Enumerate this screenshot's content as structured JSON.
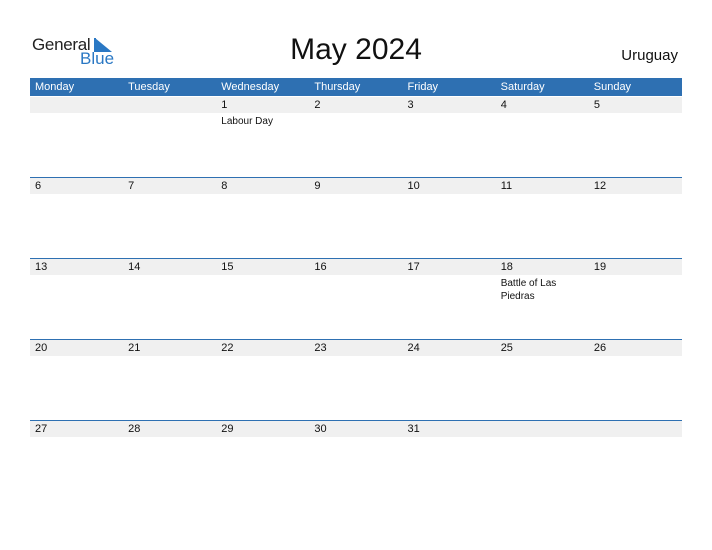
{
  "logo": {
    "general": "General",
    "blue": "Blue"
  },
  "title": "May 2024",
  "country": "Uruguay",
  "weekdays": [
    "Monday",
    "Tuesday",
    "Wednesday",
    "Thursday",
    "Friday",
    "Saturday",
    "Sunday"
  ],
  "colors": {
    "accent": "#2e70b2",
    "logo_blue": "#2a78c4",
    "date_strip": "#f0f0f0"
  },
  "weeks": [
    {
      "days": [
        {
          "d": ""
        },
        {
          "d": ""
        },
        {
          "d": "1",
          "event": "Labour Day"
        },
        {
          "d": "2"
        },
        {
          "d": "3"
        },
        {
          "d": "4"
        },
        {
          "d": "5"
        }
      ]
    },
    {
      "days": [
        {
          "d": "6"
        },
        {
          "d": "7"
        },
        {
          "d": "8"
        },
        {
          "d": "9"
        },
        {
          "d": "10"
        },
        {
          "d": "11"
        },
        {
          "d": "12"
        }
      ]
    },
    {
      "days": [
        {
          "d": "13"
        },
        {
          "d": "14"
        },
        {
          "d": "15"
        },
        {
          "d": "16"
        },
        {
          "d": "17"
        },
        {
          "d": "18",
          "event": "Battle of Las Piedras"
        },
        {
          "d": "19"
        }
      ]
    },
    {
      "days": [
        {
          "d": "20"
        },
        {
          "d": "21"
        },
        {
          "d": "22"
        },
        {
          "d": "23"
        },
        {
          "d": "24"
        },
        {
          "d": "25"
        },
        {
          "d": "26"
        }
      ]
    },
    {
      "days": [
        {
          "d": "27"
        },
        {
          "d": "28"
        },
        {
          "d": "29"
        },
        {
          "d": "30"
        },
        {
          "d": "31"
        },
        {
          "d": ""
        },
        {
          "d": ""
        }
      ]
    }
  ]
}
